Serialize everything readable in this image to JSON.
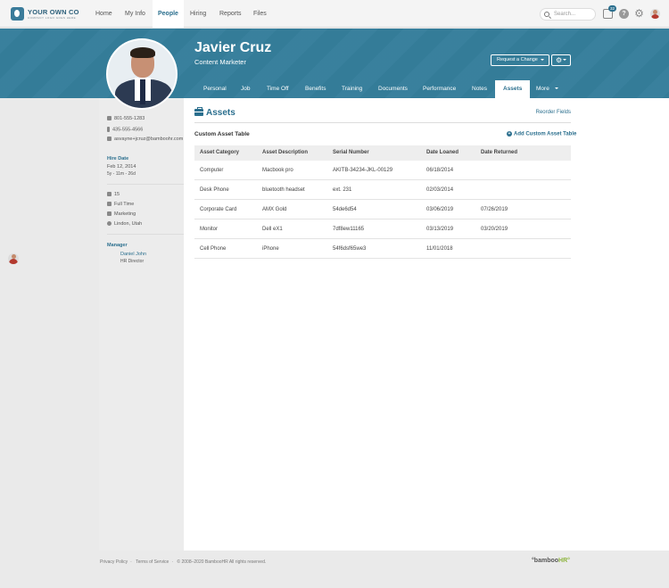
{
  "topnav": {
    "logo_name": "YOUR OWN CO",
    "logo_tagline": "COMPANY LOGO GOES HERE",
    "links": [
      "Home",
      "My Info",
      "People",
      "Hiring",
      "Reports",
      "Files"
    ],
    "active": "People",
    "search_placeholder": "Search...",
    "inbox_count": "32",
    "help_glyph": "?",
    "icons": [
      "search-icon",
      "inbox-icon",
      "help-icon",
      "gear-icon",
      "user-avatar"
    ]
  },
  "header": {
    "name": "Javier Cruz",
    "title": "Content Marketer",
    "request_change": "Request a Change",
    "accent": "#357e9b"
  },
  "tabs": [
    "Personal",
    "Job",
    "Time Off",
    "Benefits",
    "Training",
    "Documents",
    "Performance",
    "Notes",
    "Assets",
    "More"
  ],
  "active_tab": "Assets",
  "sidebar": {
    "work_phone": "801-555-1283",
    "mobile_phone": "435-555-4566",
    "email": "asvayne+jcruz@bamboohr.com",
    "hire_date_label": "Hire Date",
    "hire_date": "Feb 12, 2014",
    "tenure": "5y - 11m - 26d",
    "employee_number": "15",
    "employment_status": "Full Time",
    "department": "Marketing",
    "location": "Lindon, Utah",
    "manager_label": "Manager",
    "manager_name": "Daniel John",
    "manager_title": "HR Director"
  },
  "main": {
    "section_title": "Assets",
    "reorder_fields": "Reorder Fields",
    "table_title": "Custom Asset Table",
    "add_table": "Add Custom Asset Table",
    "columns": [
      "Asset Category",
      "Asset Description",
      "Serial Number",
      "Date Loaned",
      "Date Returned"
    ],
    "rows": [
      [
        "Computer",
        "Macbook pro",
        "AKITB-34234-JKL-00129",
        "06/18/2014",
        ""
      ],
      [
        "Desk Phone",
        "bluetooth headset",
        "ext. 231",
        "02/03/2014",
        ""
      ],
      [
        "Corporate Card",
        "AMX Gold",
        "54de6d54",
        "03/06/2019",
        "07/26/2019"
      ],
      [
        "Monitor",
        "Dell eX1",
        "7df8ew11165",
        "03/13/2019",
        "03/20/2019"
      ],
      [
        "Cell Phone",
        "iPhone",
        "54f6dsf65we3",
        "11/01/2018",
        ""
      ]
    ]
  },
  "footer": {
    "privacy": "Privacy Policy",
    "terms": "Terms of Service",
    "copyright": "© 2008–2020 BambooHR All rights reserved.",
    "brand_prefix": "°bamboo",
    "brand_suffix": "HR°"
  }
}
